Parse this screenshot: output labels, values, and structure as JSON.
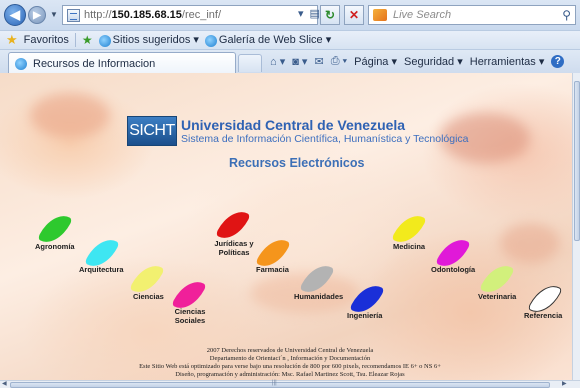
{
  "browser": {
    "url_prefix": "http://",
    "url_host": "150.185.68.15",
    "url_path": "/rec_inf/",
    "search_placeholder": "Live Search",
    "tab_title": "Recursos de Informacion",
    "favorites_label": "Favoritos",
    "fav_links": [
      "Sitios sugeridos ▾",
      "Galería de Web Slice ▾"
    ],
    "commands": {
      "page": "Página ▾",
      "security": "Seguridad ▾",
      "tools": "Herramientas ▾"
    }
  },
  "page": {
    "logo_text": "SICHT",
    "university": "Universidad Central de Venezuela",
    "system_name": "Sistema de Información Científica, Humanística y Tecnológica",
    "section_title": "Recursos Electrónicos",
    "categories": [
      {
        "label": "Agronomía",
        "color": "#2ec92e"
      },
      {
        "label": "Arquitectura",
        "color": "#3ee6f2"
      },
      {
        "label": "Ciencias",
        "color": "#f2f070"
      },
      {
        "label": "Ciencias Sociales",
        "color": "#f0209a"
      },
      {
        "label": "Jurídicas y Políticas",
        "color": "#e01414"
      },
      {
        "label": "Farmacia",
        "color": "#f5951c"
      },
      {
        "label": "Humanidades",
        "color": "#b3b3b3"
      },
      {
        "label": "Ingeniería",
        "color": "#1a2fd8"
      },
      {
        "label": "Medicina",
        "color": "#f2ea1c"
      },
      {
        "label": "Odontología",
        "color": "#e019d8"
      },
      {
        "label": "Veterinaria",
        "color": "#d2f07c"
      },
      {
        "label": "Referencia",
        "color": "#ffffff"
      }
    ],
    "footer": [
      "2007 Derechos reservados de Universidad Central de Venezuela",
      "Departamento de Orientaci´n , Información y Documentación",
      "Este Sitio Web está optimizado para verse bajo una resolución de 800 por 600 pixels, recomendamos IE 6+ o NS 6+",
      "Diseño, programación y administración: Msc. Rafael Martinez Scott, Tsu. Eleazar Rojas"
    ]
  }
}
